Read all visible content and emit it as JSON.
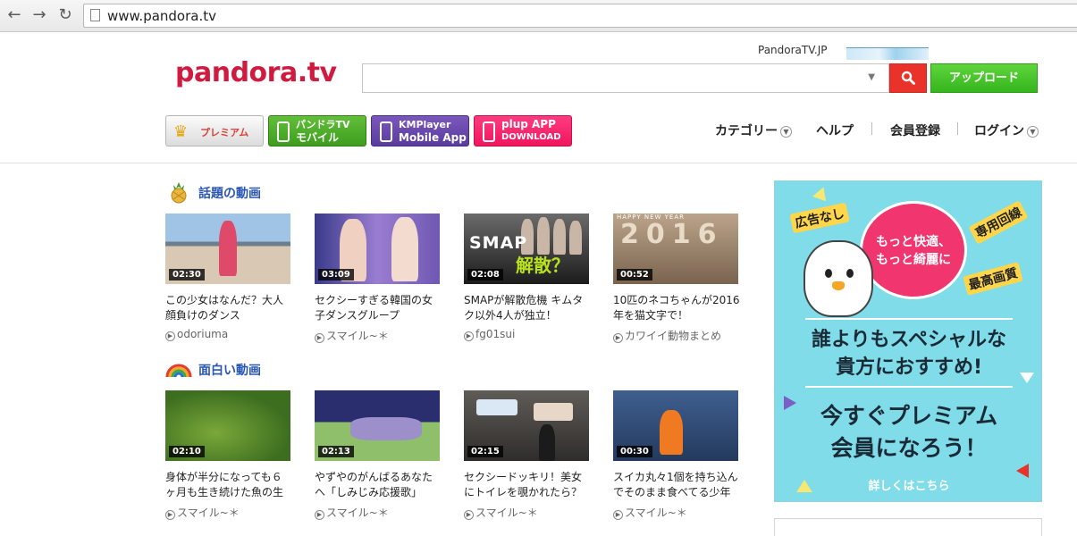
{
  "browser": {
    "url": "www.pandora.tv"
  },
  "header": {
    "jp_link": "PandoraTV.JP",
    "logo": "pandora.tv",
    "search_placeholder": "",
    "upload_label": "アップロード"
  },
  "promos": {
    "premium": "プレミアム",
    "mobile_l1": "パンドラTV",
    "mobile_l2": "モバイル",
    "km_l1": "KMPlayer",
    "km_l2": "Mobile App",
    "plup_l1": "plup APP",
    "plup_l2": "DOWNLOAD"
  },
  "nav": {
    "category": "カテゴリー",
    "help": "ヘルプ",
    "register": "会員登録",
    "login": "ログイン"
  },
  "sections": [
    {
      "title": "話題の動画",
      "videos": [
        {
          "duration": "02:30",
          "title": "この少女はなんだ？大人顔負けのダンス",
          "author": "odoriuma"
        },
        {
          "duration": "03:09",
          "title": "セクシーすぎる韓国の女子ダンスグループ",
          "author": "スマイル~＊"
        },
        {
          "duration": "02:08",
          "title": "SMAPが解散危機 キムタク以外4人が独立！",
          "author": "fg01sui"
        },
        {
          "duration": "00:52",
          "title": "10匹のネコちゃんが2016年を猫文字で！",
          "author": "カワイイ動物まとめ"
        }
      ]
    },
    {
      "title": "面白い動画",
      "videos": [
        {
          "duration": "02:10",
          "title": "身体が半分になっても６ヶ月も生き続けた魚の生",
          "author": "スマイル~＊"
        },
        {
          "duration": "02:13",
          "title": "やずやのがんばるあなたへ「しみじみ応援歌」",
          "author": "スマイル~＊"
        },
        {
          "duration": "02:15",
          "title": "セクシードッキリ！美女にトイレを覗かれたら？",
          "author": "スマイル~＊"
        },
        {
          "duration": "00:30",
          "title": "スイカ丸々1個を持ち込んでそのまま食べてる少年",
          "author": "スマイル~＊"
        }
      ]
    }
  ],
  "thumb_text": {
    "smap": "SMAP",
    "kaisan": "解散？",
    "hny": "HAPPY NEW YEAR",
    "year": "2016"
  },
  "ad": {
    "bubble_l1": "もっと快適、",
    "bubble_l2": "もっと綺麗に",
    "tag_noads": "広告なし",
    "tag_line": "専用回線",
    "tag_quality": "最高画質",
    "headline_l1": "誰よりもスペシャルな",
    "headline_l2": "貴方におすすめ!",
    "cta_l1": "今すぐプレミアム",
    "cta_l2": "会員になろう！",
    "more": "詳しくはこちら"
  },
  "colors": {
    "brand": "#cf1b40",
    "search": "#e8322a",
    "upload": "#35b51c",
    "section_title": "#2a56b4",
    "ad_bg": "#7fdce8"
  },
  "icons": {
    "back": "arrow-left",
    "forward": "arrow-right",
    "reload": "reload",
    "search": "magnifier",
    "crown": "crown",
    "pineapple": "pineapple",
    "rainbow": "rainbow"
  }
}
